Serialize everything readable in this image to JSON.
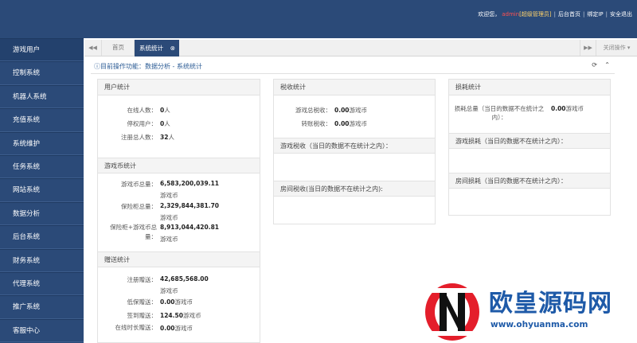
{
  "header": {
    "welcome": "欢迎您，",
    "username": "admin",
    "role": "[超级管理员]",
    "links": [
      "后台首页",
      "绑定IP",
      "安全退出"
    ]
  },
  "sidebar": {
    "items": [
      "游戏用户",
      "控制系统",
      "机器人系统",
      "充值系统",
      "系统维护",
      "任务系统",
      "网站系统",
      "数据分析",
      "后台系统",
      "财务系统",
      "代理系统",
      "推广系统",
      "客服中心"
    ]
  },
  "tabs": {
    "home": "首页",
    "active": "系统统计",
    "close_ops": "关闭操作"
  },
  "breadcrumb": "目前操作功能：数据分析 - 系统统计",
  "user_stats": {
    "title": "用户统计",
    "rows": [
      {
        "label": "在线人数：",
        "value": "0",
        "unit": "人"
      },
      {
        "label": "停权用户：",
        "value": "0",
        "unit": "人"
      },
      {
        "label": "注册总人数：",
        "value": "32",
        "unit": "人"
      }
    ]
  },
  "coin_stats": {
    "title": "游戏币统计",
    "rows": [
      {
        "label": "游戏币总量：",
        "value": "6,583,200,039.11",
        "unit": "游戏币"
      },
      {
        "label": "保险柜总量：",
        "value": "2,329,844,381.70",
        "unit": "游戏币"
      },
      {
        "label": "保险柜+游戏币总量：",
        "value": "8,913,044,420.81",
        "unit": "游戏币"
      }
    ]
  },
  "gift_stats": {
    "title": "赠送统计",
    "rows": [
      {
        "label": "注册赠送：",
        "value": "42,685,568.00",
        "unit": "游戏币"
      },
      {
        "label": "低保赠送：",
        "value": "0.00",
        "unit": "游戏币"
      },
      {
        "label": "签到赠送：",
        "value": "124.50",
        "unit": "游戏币"
      },
      {
        "label": "在线时长赠送：",
        "value": "0.00",
        "unit": "游戏币"
      }
    ]
  },
  "tax_stats": {
    "title": "税收统计",
    "rows": [
      {
        "label": "游戏总税收：",
        "value": "0.00",
        "unit": "游戏币"
      },
      {
        "label": "转账税收：",
        "value": "0.00",
        "unit": "游戏币"
      }
    ],
    "game_tax_title": "游戏税收（当日的数据不在统计之内）：",
    "room_tax_title": "房间税收(当日的数据不在统计之内):"
  },
  "loss_stats": {
    "title": "损耗统计",
    "total_label": "损耗总量（当日的数据不在统计之内）：",
    "total_value": "0.00",
    "total_unit": "游戏币",
    "game_loss_title": "游戏损耗（当日的数据不在统计之内）：",
    "room_loss_title": "房间损耗（当日的数据不在统计之内）："
  },
  "watermark": {
    "text": "欧皇源码网",
    "url": "www.ohyuanma.com"
  }
}
